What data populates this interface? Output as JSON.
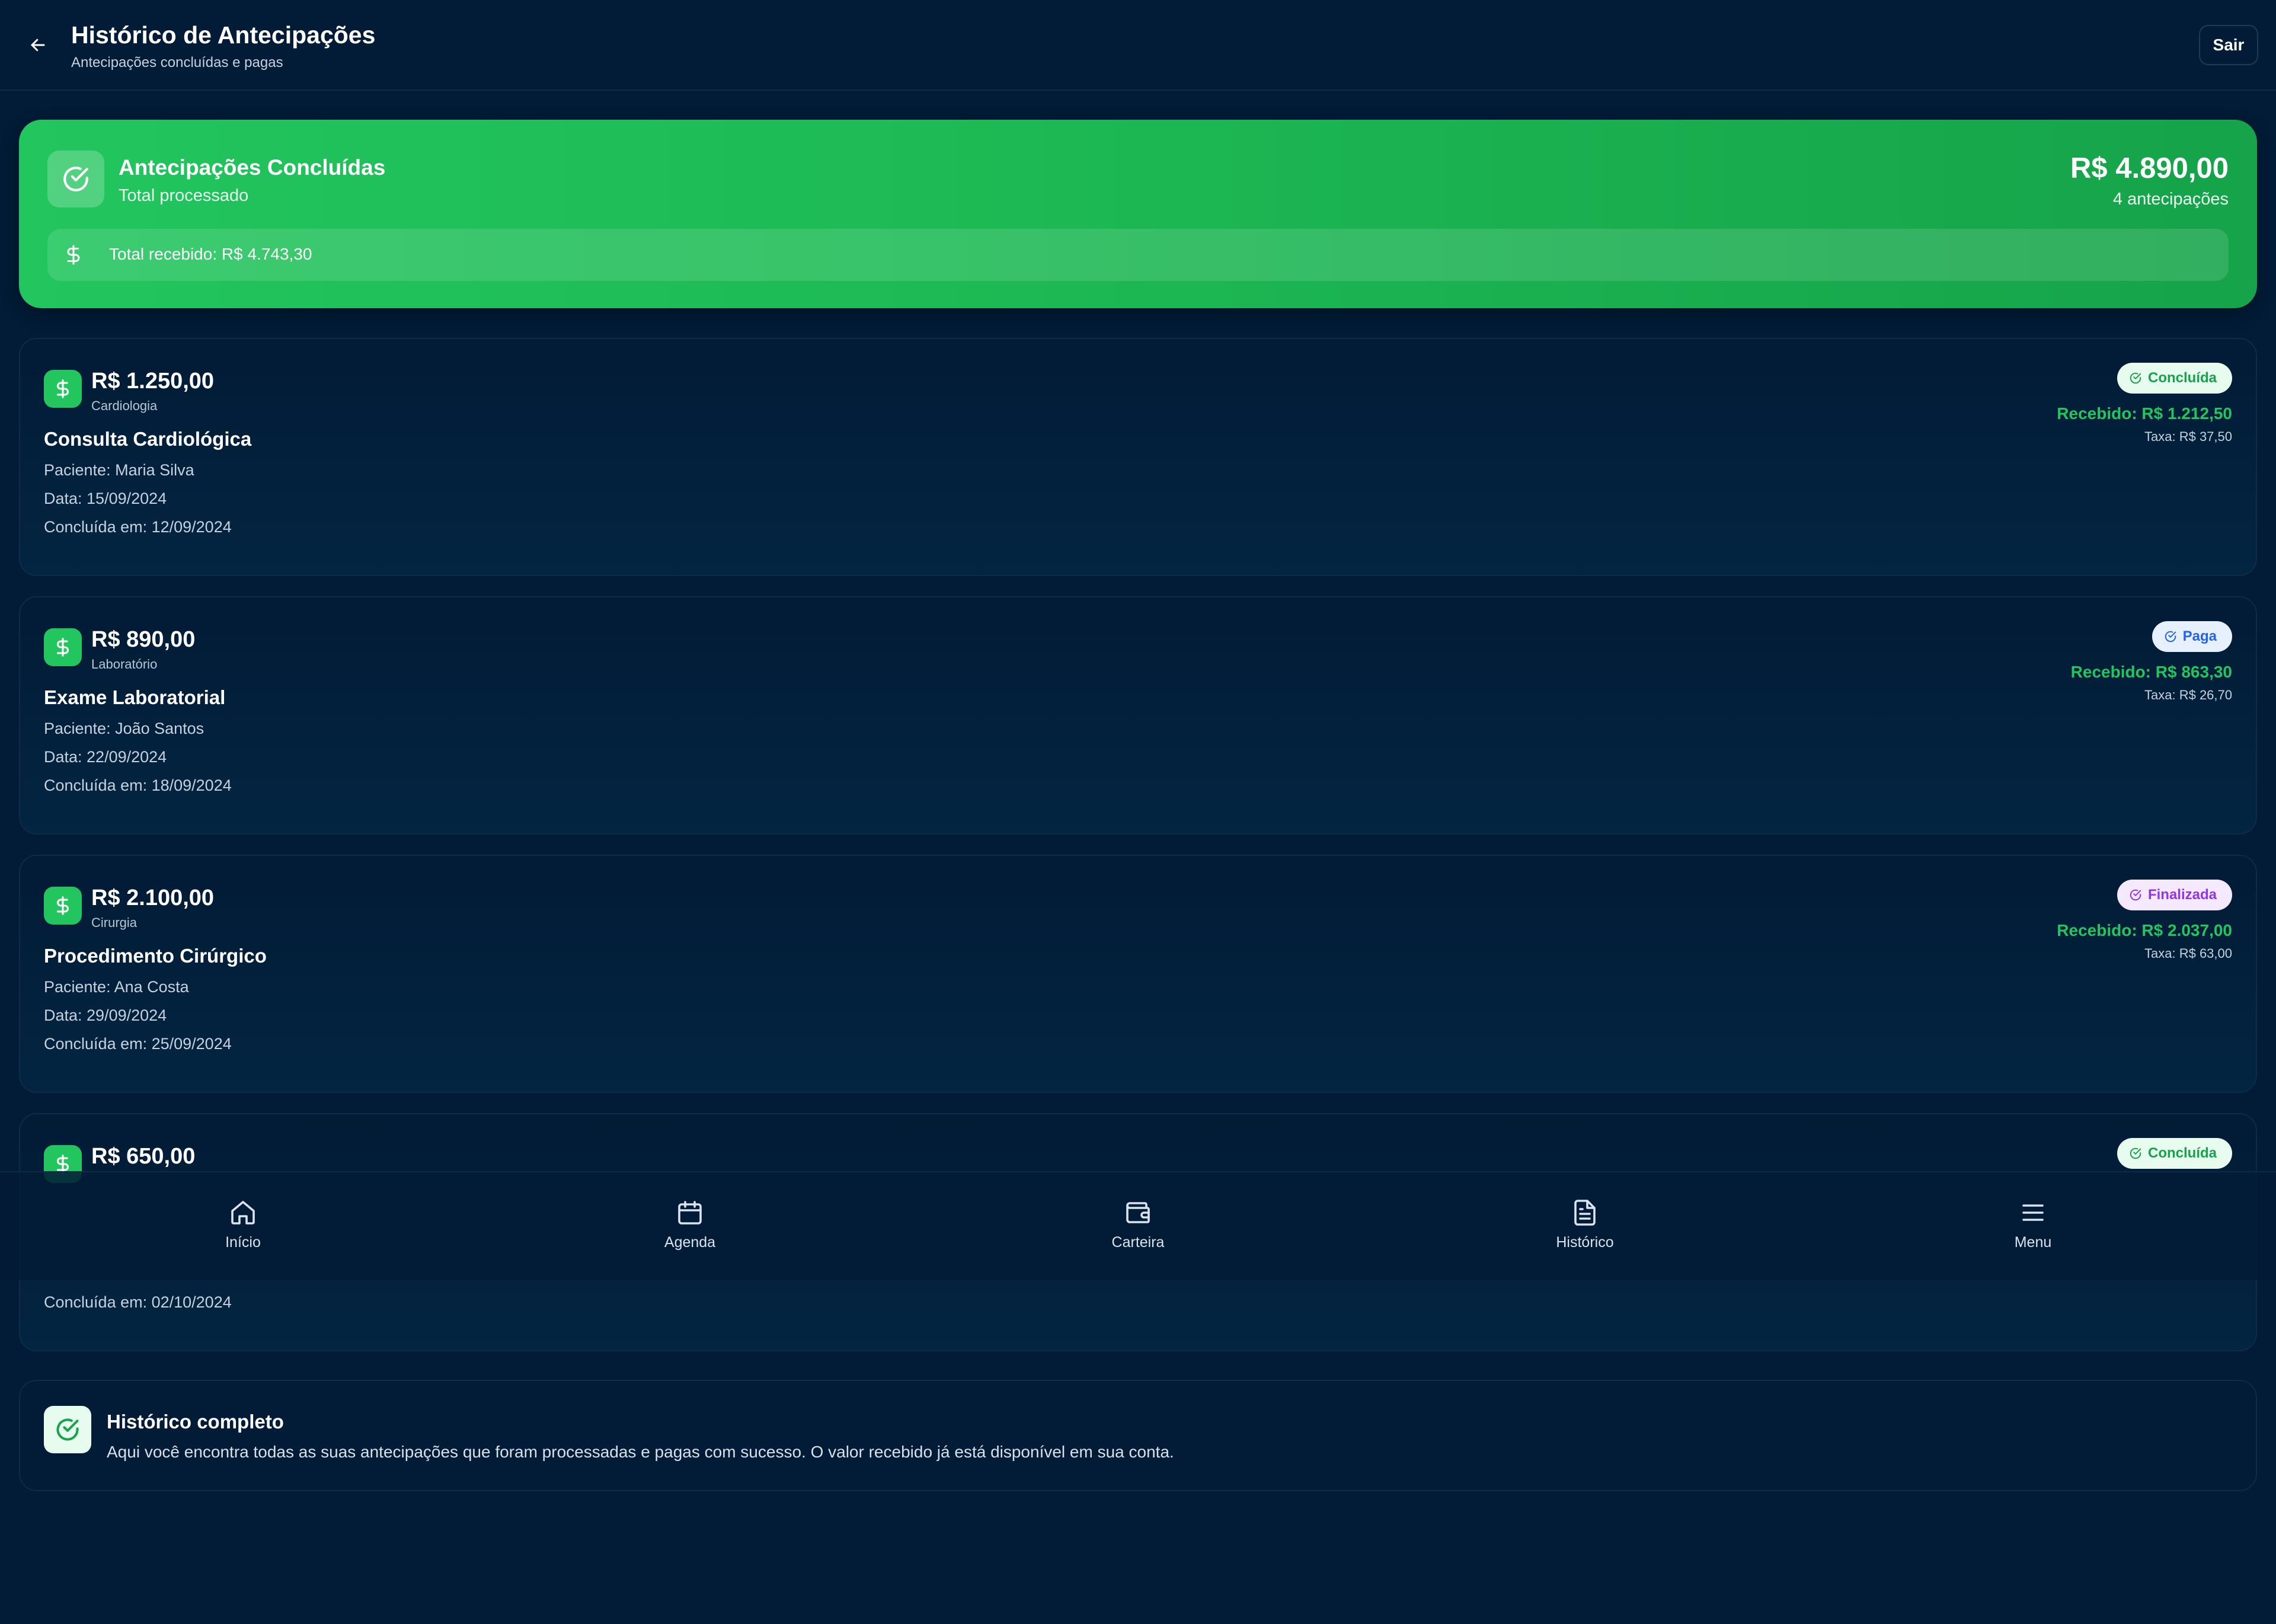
{
  "header": {
    "title": "Histórico de Antecipações",
    "subtitle": "Antecipações concluídas e pagas",
    "logout_label": "Sair"
  },
  "summary": {
    "title": "Antecipações Concluídas",
    "subtitle": "Total processado",
    "total": "R$ 4.890,00",
    "count": "4 antecipações",
    "received": "Total recebido: R$ 4.743,30"
  },
  "items": [
    {
      "amount": "R$ 1.250,00",
      "category": "Cardiologia",
      "title": "Consulta Cardiológica",
      "patient": "Paciente: Maria Silva",
      "date": "Data: 15/09/2024",
      "concluded": "Concluída em: 12/09/2024",
      "status": "Concluída",
      "received": "Recebido: R$ 1.212,50",
      "fee": "Taxa: R$ 37,50"
    },
    {
      "amount": "R$ 890,00",
      "category": "Laboratório",
      "title": "Exame Laboratorial",
      "patient": "Paciente: João Santos",
      "date": "Data: 22/09/2024",
      "concluded": "Concluída em: 18/09/2024",
      "status": "Paga",
      "received": "Recebido: R$ 863,30",
      "fee": "Taxa: R$ 26,70"
    },
    {
      "amount": "R$ 2.100,00",
      "category": "Cirurgia",
      "title": "Procedimento Cirúrgico",
      "patient": "Paciente: Ana Costa",
      "date": "Data: 29/09/2024",
      "concluded": "Concluída em: 25/09/2024",
      "status": "Finalizada",
      "received": "Recebido: R$ 2.037,00",
      "fee": "Taxa: R$ 63,00"
    },
    {
      "amount": "R$ 650,00",
      "concluded": "Concluída em: 02/10/2024",
      "status": "Concluída"
    }
  ],
  "info": {
    "title": "Histórico completo",
    "text": "Aqui você encontra todas as suas antecipações que foram processadas e pagas com sucesso. O valor recebido já está disponível em sua conta."
  },
  "nav": {
    "home": "Início",
    "agenda": "Agenda",
    "wallet": "Carteira",
    "history": "Histórico",
    "menu": "Menu"
  },
  "colors": {
    "background": "#021b36",
    "accent_green": "#22c55e",
    "status_blue": "#2563eb",
    "status_purple": "#9333ea"
  }
}
